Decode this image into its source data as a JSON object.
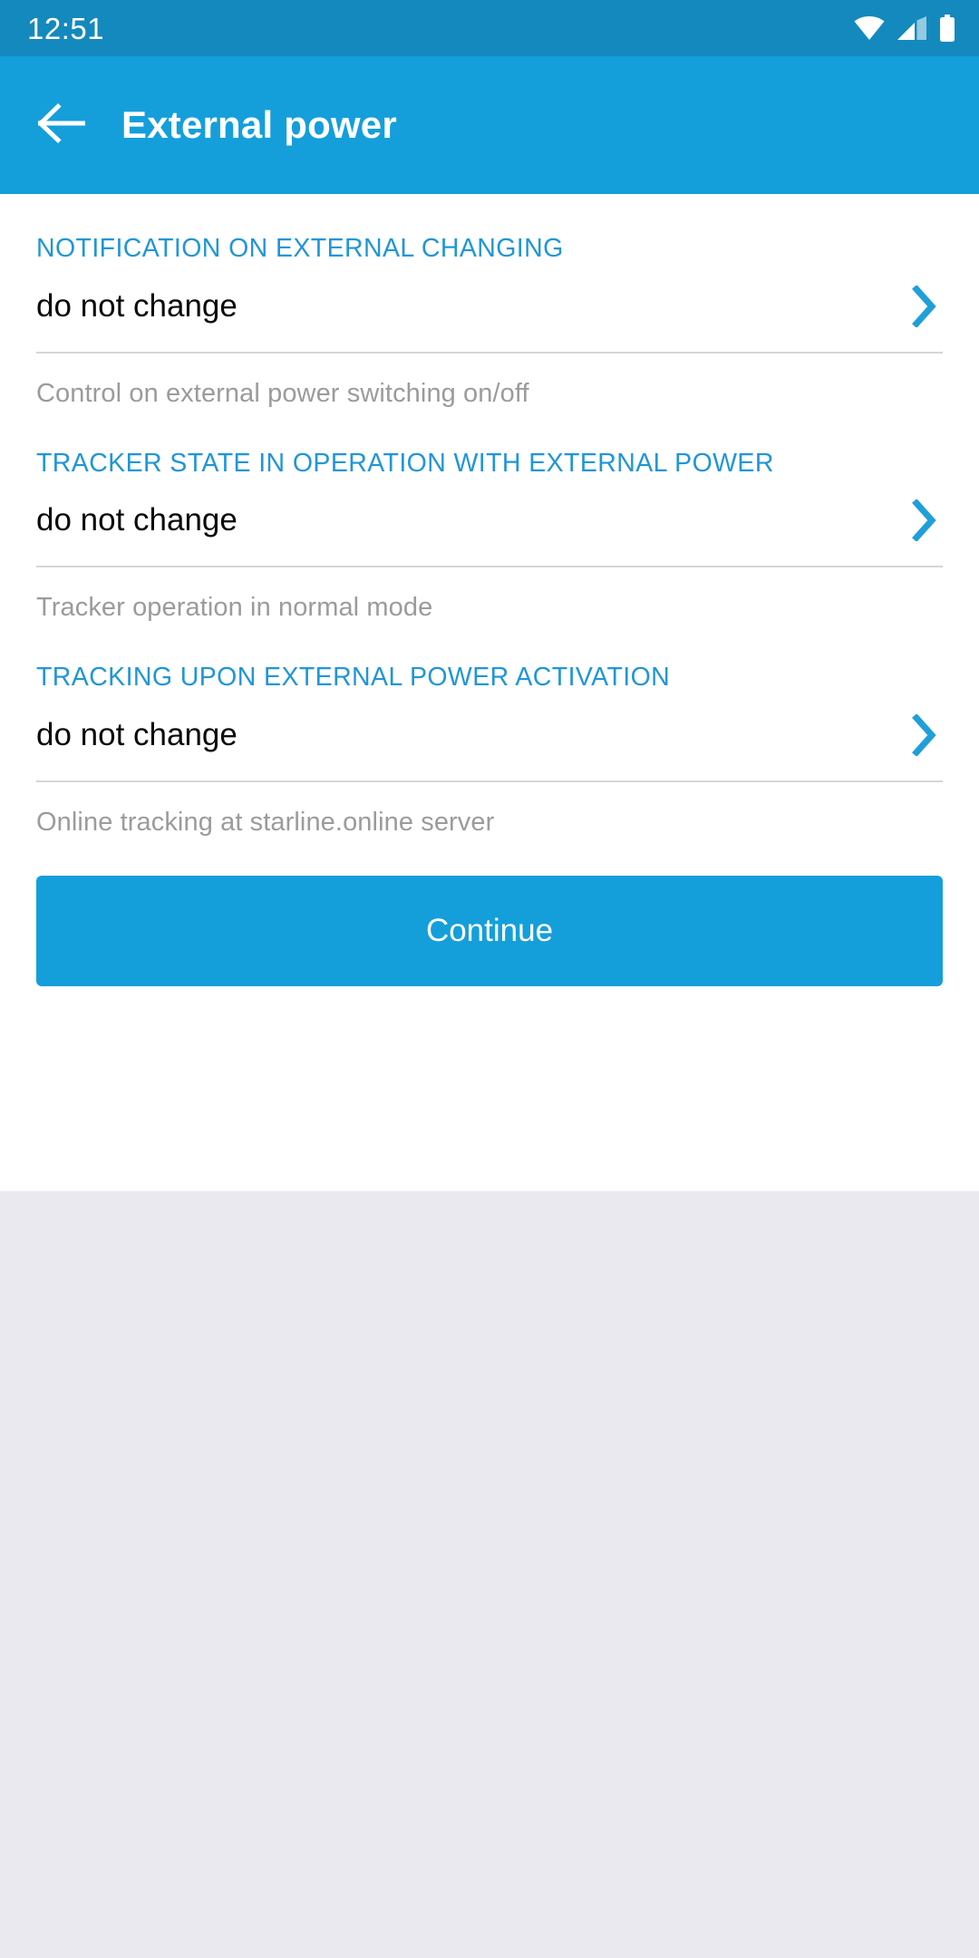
{
  "status_bar": {
    "time": "12:51",
    "icons": [
      {
        "name": "wifi-icon"
      },
      {
        "name": "cellular-signal-icon"
      },
      {
        "name": "battery-icon"
      }
    ]
  },
  "app_bar": {
    "back_icon": "arrow-left-icon",
    "title": "External power"
  },
  "settings": {
    "groups": [
      {
        "label": "NOTIFICATION ON EXTERNAL CHANGING",
        "value": "do not change",
        "chevron_icon": "chevron-right-icon",
        "helper": "Control on external power switching on/off"
      },
      {
        "label": "TRACKER STATE IN OPERATION WITH EXTERNAL POWER",
        "value": "do not change",
        "chevron_icon": "chevron-right-icon",
        "helper": "Tracker operation in normal mode"
      },
      {
        "label": "TRACKING UPON EXTERNAL POWER ACTIVATION",
        "value": "do not change",
        "chevron_icon": "chevron-right-icon",
        "helper": "Online tracking at starline.online server"
      }
    ]
  },
  "footer": {
    "continue_label": "Continue"
  },
  "colors": {
    "status_bar_blue": "#1489be",
    "app_bar_blue": "#149fdb",
    "accent_blue": "#2196d6",
    "chevron_blue": "#1f9fd9",
    "value_text": "#0a0a0a",
    "helper_text": "#9b9b9b",
    "divider": "#d6d6d6",
    "page_background": "#e9e9ef",
    "content_background": "#ffffff"
  }
}
